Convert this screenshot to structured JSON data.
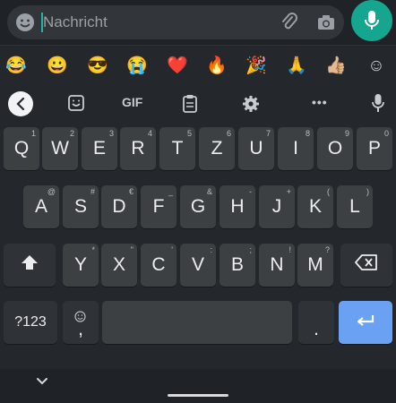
{
  "compose": {
    "placeholder": "Nachricht",
    "icons": [
      "emoji-icon",
      "attach-icon",
      "camera-icon",
      "mic-icon"
    ],
    "accent": "#16a58f"
  },
  "emoji_strip": [
    "😂",
    "😀",
    "😎",
    "😭",
    "❤️",
    "🔥",
    "🎉",
    "🙏",
    "👍🏼",
    "☺"
  ],
  "toolbar": {
    "gif_label": "GIF",
    "more_label": "•••"
  },
  "keyboard": {
    "row1": [
      {
        "k": "Q",
        "h": "1"
      },
      {
        "k": "W",
        "h": "2"
      },
      {
        "k": "E",
        "h": "3"
      },
      {
        "k": "R",
        "h": "4"
      },
      {
        "k": "T",
        "h": "5"
      },
      {
        "k": "Z",
        "h": "6"
      },
      {
        "k": "U",
        "h": "7"
      },
      {
        "k": "I",
        "h": "8"
      },
      {
        "k": "O",
        "h": "9"
      },
      {
        "k": "P",
        "h": "0"
      }
    ],
    "row2": [
      {
        "k": "A",
        "h": "@"
      },
      {
        "k": "S",
        "h": "#"
      },
      {
        "k": "D",
        "h": "€"
      },
      {
        "k": "F",
        "h": "_"
      },
      {
        "k": "G",
        "h": "&"
      },
      {
        "k": "H",
        "h": "-"
      },
      {
        "k": "J",
        "h": "+"
      },
      {
        "k": "K",
        "h": "("
      },
      {
        "k": "L",
        "h": ")"
      }
    ],
    "row3": [
      {
        "k": "Y",
        "h": "*"
      },
      {
        "k": "X",
        "h": "\""
      },
      {
        "k": "C",
        "h": "'"
      },
      {
        "k": "V",
        "h": ":"
      },
      {
        "k": "B",
        "h": ";"
      },
      {
        "k": "N",
        "h": "!"
      },
      {
        "k": "M",
        "h": "?"
      }
    ],
    "symbols_label": "?123",
    "comma_label": ",",
    "period_label": ".",
    "enter_color": "#6aa1f2"
  }
}
